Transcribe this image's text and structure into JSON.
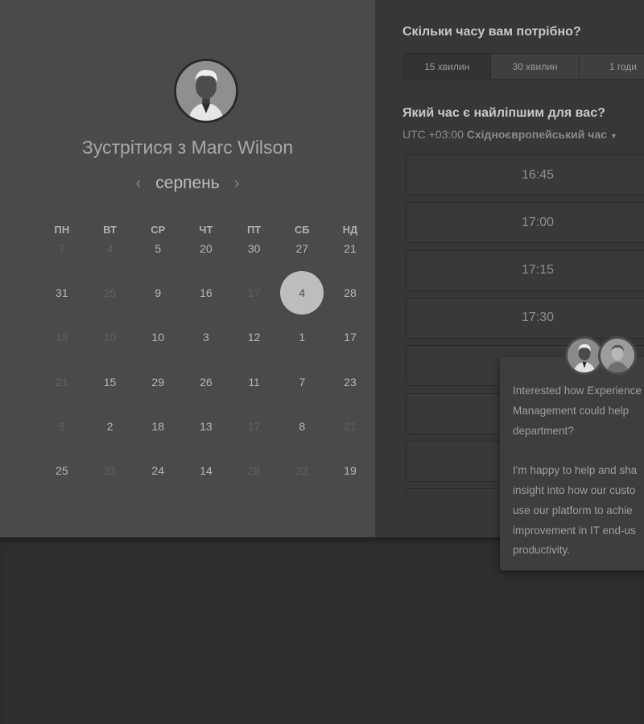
{
  "booking": {
    "title": "Зустрітися з Marc Wilson",
    "month": "серпень",
    "weekdays": [
      "ПН",
      "ВТ",
      "СР",
      "ЧТ",
      "ПТ",
      "СБ",
      "НД"
    ],
    "calendar_rows": [
      [
        {
          "d": "7",
          "dim": true
        },
        {
          "d": "4",
          "dim": true
        },
        {
          "d": "5"
        },
        {
          "d": "20"
        },
        {
          "d": "30"
        },
        {
          "d": "27"
        },
        {
          "d": "21"
        }
      ],
      [
        {
          "d": "31"
        },
        {
          "d": "25",
          "dim": true
        },
        {
          "d": "9"
        },
        {
          "d": "16"
        },
        {
          "d": "17",
          "dim": true
        },
        {
          "d": "4",
          "selected": true
        },
        {
          "d": "28"
        }
      ],
      [
        {
          "d": "13",
          "dim": true
        },
        {
          "d": "10",
          "dim": true
        },
        {
          "d": "10"
        },
        {
          "d": "3"
        },
        {
          "d": "12"
        },
        {
          "d": "1"
        },
        {
          "d": "17"
        }
      ],
      [
        {
          "d": "21",
          "dim": true
        },
        {
          "d": "15"
        },
        {
          "d": "29"
        },
        {
          "d": "26"
        },
        {
          "d": "11"
        },
        {
          "d": "7"
        },
        {
          "d": "23"
        }
      ],
      [
        {
          "d": "5",
          "dim": true
        },
        {
          "d": "2"
        },
        {
          "d": "18"
        },
        {
          "d": "13"
        },
        {
          "d": "17",
          "dim": true
        },
        {
          "d": "8"
        },
        {
          "d": "21",
          "dim": true
        }
      ],
      [
        {
          "d": "25"
        },
        {
          "d": "31",
          "dim": true
        },
        {
          "d": "24"
        },
        {
          "d": "14"
        },
        {
          "d": "28",
          "dim": true
        },
        {
          "d": "22",
          "dim": true
        },
        {
          "d": "19"
        }
      ]
    ]
  },
  "duration": {
    "question": "Скільки часу вам потрібно?",
    "options": [
      "15 хвилин",
      "30 хвилин",
      "1 годи"
    ]
  },
  "time": {
    "question": "Який час є найліпшим для вас?",
    "tz_offset": "UTC +03:00",
    "tz_name": "Східноєвропейський час",
    "slots": [
      "16:45",
      "17:00",
      "17:15",
      "17:30",
      "",
      "",
      "",
      ""
    ]
  },
  "chat": {
    "lines": [
      "Interested how Experience",
      "Management could help",
      "department?",
      "",
      "I'm happy to help and sha",
      "insight into how our custo",
      "use our platform to achie",
      "improvement in IT end-us",
      "productivity."
    ]
  },
  "colors": {
    "left_panel": "#4a4a4a",
    "right_panel": "#373737",
    "selected_day": "#bdbdbd"
  }
}
